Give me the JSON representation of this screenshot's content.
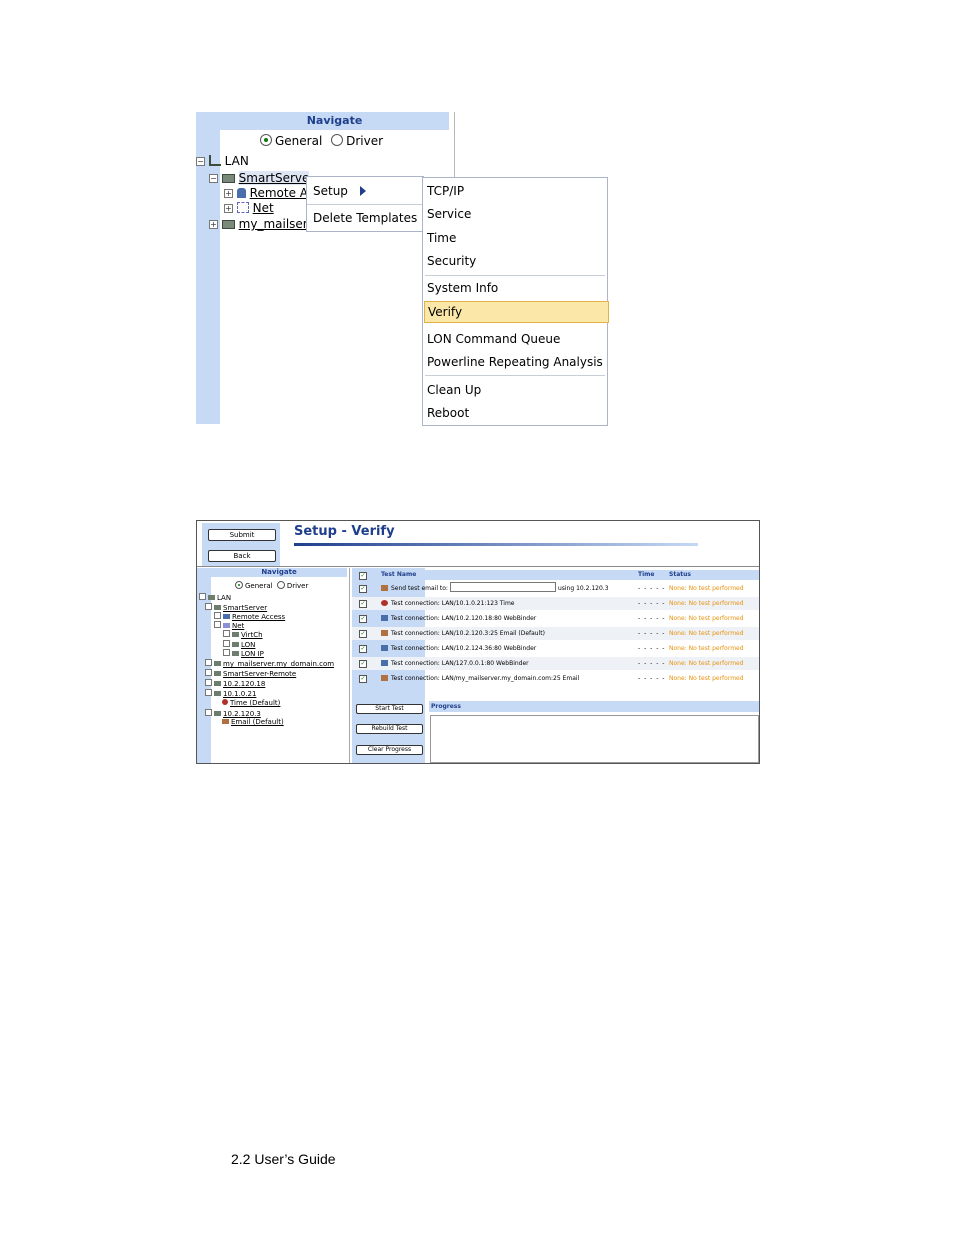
{
  "screenshot1": {
    "navigate_title": "Navigate",
    "radio_general": "General",
    "radio_driver": "Driver",
    "tree": {
      "lan": "LAN",
      "smartserver": "SmartServe",
      "remote": "Remote A",
      "net": "Net",
      "mailserver": "my_mailser"
    },
    "context_menu": {
      "setup": "Setup",
      "delete_templates": "Delete Templates"
    },
    "submenu": {
      "group1": [
        "TCP/IP",
        "Service",
        "Time",
        "Security"
      ],
      "group2": [
        "System Info",
        "Verify"
      ],
      "group3": [
        "LON Command Queue",
        "Powerline Repeating Analysis"
      ],
      "group4": [
        "Clean Up",
        "Reboot"
      ],
      "highlighted": "Verify"
    }
  },
  "screenshot2": {
    "buttons": {
      "submit": "Submit",
      "back": "Back"
    },
    "page_title": "Setup - Verify",
    "navigate_title": "Navigate",
    "radio_general": "General",
    "radio_driver": "Driver",
    "tree": [
      "LAN",
      "SmartServer",
      "Remote Access",
      "Net",
      "VirtCh",
      "LON",
      "LON IP",
      "my_mailserver.my_domain.com",
      "SmartServer-Remote",
      "10.2.120.18",
      "10.1.0.21",
      "Time (Default)",
      "10.2.120.3",
      "Email (Default)"
    ],
    "columns": {
      "test_name": "Test Name",
      "time": "Time",
      "status": "Status"
    },
    "rows": [
      {
        "name": "Send test email to:",
        "suffix": "using 10.2.120.3",
        "time": "- - - - -",
        "status": "None: No test performed"
      },
      {
        "name": "Test connection: LAN/10.1.0.21:123 Time",
        "time": "- - - - -",
        "status": "None: No test performed"
      },
      {
        "name": "Test connection: LAN/10.2.120.18:80 WebBinder",
        "time": "- - - - -",
        "status": "None: No test performed"
      },
      {
        "name": "Test connection: LAN/10.2.120.3:25 Email (Default)",
        "time": "- - - - -",
        "status": "None: No test performed"
      },
      {
        "name": "Test connection: LAN/10.2.124.36:80 WebBinder",
        "time": "- - - - -",
        "status": "None: No test performed"
      },
      {
        "name": "Test connection: LAN/127.0.0.1:80 WebBinder",
        "time": "- - - - -",
        "status": "None: No test performed"
      },
      {
        "name": "Test connection: LAN/my_mailserver.my_domain.com:25 Email",
        "time": "- - - - -",
        "status": "None: No test performed"
      }
    ],
    "action_buttons": {
      "start": "Start Test",
      "rebuild": "Rebuild Test",
      "clear": "Clear Progress"
    },
    "progress_title": "Progress",
    "colors": {
      "accent": "#1f3f8c",
      "panel": "#c6d9f5",
      "status": "#e8920c",
      "highlight": "#fbe7a8"
    }
  },
  "caption": "2.2 User’s Guide"
}
